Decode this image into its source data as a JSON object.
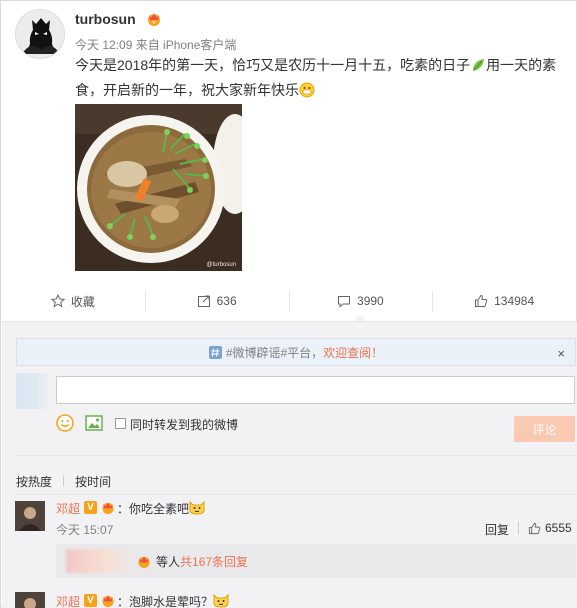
{
  "post": {
    "username": "turbosun",
    "meta": "今天 12:09 来自 iPhone客户端",
    "text_before_emoji": "今天是2018年的第一天，恰巧又是农历十一月十五，吃素的日子",
    "text_after_emoji": "用一天的素食，开启新的一年，祝大家新年快乐",
    "photo_watermark": "@turbosun",
    "photo_subject": "vegetarian noodle soup bowl"
  },
  "actions": [
    {
      "label": "收藏",
      "icon": "star-icon"
    },
    {
      "label": "636",
      "icon": "repost-icon"
    },
    {
      "label": "3990",
      "icon": "comment-icon"
    },
    {
      "label": "134984",
      "icon": "like-icon"
    }
  ],
  "notice": {
    "hash": "#微博辟谣#平台，",
    "link": "欢迎查阅！",
    "close": "×"
  },
  "composer": {
    "input_value": "",
    "repost_label": "同时转发到我的微博",
    "submit_label": "评论"
  },
  "sort": {
    "hot": "按热度",
    "time": "按时间"
  },
  "comments": [
    {
      "name": "邓超",
      "text": "：你吃全素吧",
      "time": "今天 15:07",
      "reply": "回复",
      "likes": "6555"
    },
    {
      "name": "邓超",
      "text": "：泡脚水是荤吗？"
    }
  ],
  "sub_replies": {
    "prefix": "等人",
    "count": "共167条回复"
  },
  "colors": {
    "accent": "#eb7350",
    "comment_bg": "#f2f2f5",
    "notice_bg": "#eaf1f8",
    "submit_disabled": "#f9c9b2"
  }
}
